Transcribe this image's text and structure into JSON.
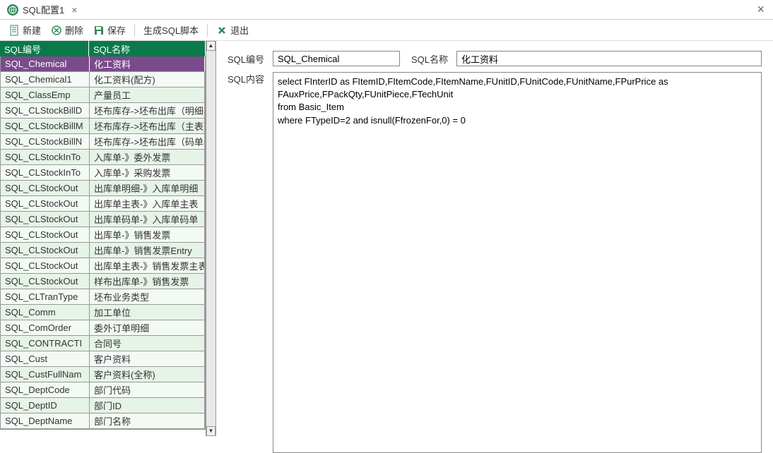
{
  "tab": {
    "title": "SQL配置1"
  },
  "toolbar": {
    "new": "新建",
    "delete": "删除",
    "save": "保存",
    "gen_script": "生成SQL脚本",
    "exit": "退出"
  },
  "list": {
    "header_id": "SQL编号",
    "header_name": "SQL名称",
    "rows": [
      {
        "id": "SQL_Chemical",
        "name": "化工资料",
        "selected": true
      },
      {
        "id": "SQL_Chemical1",
        "name": "化工资料(配方)"
      },
      {
        "id": "SQL_ClassEmp",
        "name": "产量员工"
      },
      {
        "id": "SQL_CLStockBillD",
        "name": "坯布库存->坯布出库（明细表）"
      },
      {
        "id": "SQL_CLStockBillM",
        "name": "坯布库存->坯布出库（主表）"
      },
      {
        "id": "SQL_CLStockBillN",
        "name": "坯布库存->坯布出库（码单表）"
      },
      {
        "id": "SQL_CLStockInTo",
        "name": "入库单-》委外发票"
      },
      {
        "id": "SQL_CLStockInTo",
        "name": "入库单-》采购发票"
      },
      {
        "id": "SQL_CLStockOut",
        "name": "出库单明细-》入库单明细"
      },
      {
        "id": "SQL_CLStockOut",
        "name": "出库单主表-》入库单主表"
      },
      {
        "id": "SQL_CLStockOut",
        "name": "出库单码单-》入库单码单"
      },
      {
        "id": "SQL_CLStockOut",
        "name": "出库单-》销售发票"
      },
      {
        "id": "SQL_CLStockOut",
        "name": "出库单-》销售发票Entry"
      },
      {
        "id": "SQL_CLStockOut",
        "name": "出库单主表-》销售发票主表"
      },
      {
        "id": "SQL_CLStockOut",
        "name": "样布出库单-》销售发票"
      },
      {
        "id": "SQL_CLTranType",
        "name": "坯布业务类型"
      },
      {
        "id": "SQL_Comm",
        "name": "加工单位"
      },
      {
        "id": "SQL_ComOrder",
        "name": "委外订单明细"
      },
      {
        "id": "SQL_CONTRACTI",
        "name": "合同号"
      },
      {
        "id": "SQL_Cust",
        "name": "客户资料"
      },
      {
        "id": "SQL_CustFullNam",
        "name": "客户资料(全称)"
      },
      {
        "id": "SQL_DeptCode",
        "name": "部门代码"
      },
      {
        "id": "SQL_DeptID",
        "name": "部门ID"
      },
      {
        "id": "SQL_DeptName",
        "name": "部门名称"
      }
    ]
  },
  "form": {
    "label_id": "SQL编号",
    "value_id": "SQL_Chemical",
    "label_name": "SQL名称",
    "value_name": "化工资料",
    "label_content": "SQL内容",
    "value_content": "select FInterID as FItemID,FItemCode,FItemName,FUnitID,FUnitCode,FUnitName,FPurPrice as FAuxPrice,FPackQty,FUnitPiece,FTechUnit\nfrom Basic_Item\nwhere FTypeID=2 and isnull(FfrozenFor,0) = 0"
  }
}
